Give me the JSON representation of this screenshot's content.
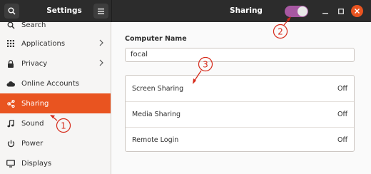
{
  "header": {
    "left_title": "Settings",
    "right_title": "Sharing",
    "sharing_toggle_on": true,
    "accent_color": "#a758a2"
  },
  "sidebar": {
    "items": [
      {
        "label": "Search",
        "icon": "search-icon"
      },
      {
        "label": "Applications",
        "icon": "apps-grid-icon",
        "has_arrow": true
      },
      {
        "label": "Privacy",
        "icon": "lock-icon",
        "has_arrow": true
      },
      {
        "label": "Online Accounts",
        "icon": "cloud-icon"
      },
      {
        "label": "Sharing",
        "icon": "share-icon",
        "active": true
      },
      {
        "label": "Sound",
        "icon": "music-note-icon"
      },
      {
        "label": "Power",
        "icon": "power-icon"
      },
      {
        "label": "Displays",
        "icon": "display-icon"
      }
    ],
    "active_color": "#e95420"
  },
  "main": {
    "computer_name_label": "Computer Name",
    "computer_name_value": "focal",
    "rows": [
      {
        "label": "Screen Sharing",
        "state": "Off"
      },
      {
        "label": "Media Sharing",
        "state": "Off"
      },
      {
        "label": "Remote Login",
        "state": "Off"
      }
    ]
  },
  "annotations": {
    "color": "#d62a1a",
    "markers": [
      "1",
      "2",
      "3"
    ]
  }
}
